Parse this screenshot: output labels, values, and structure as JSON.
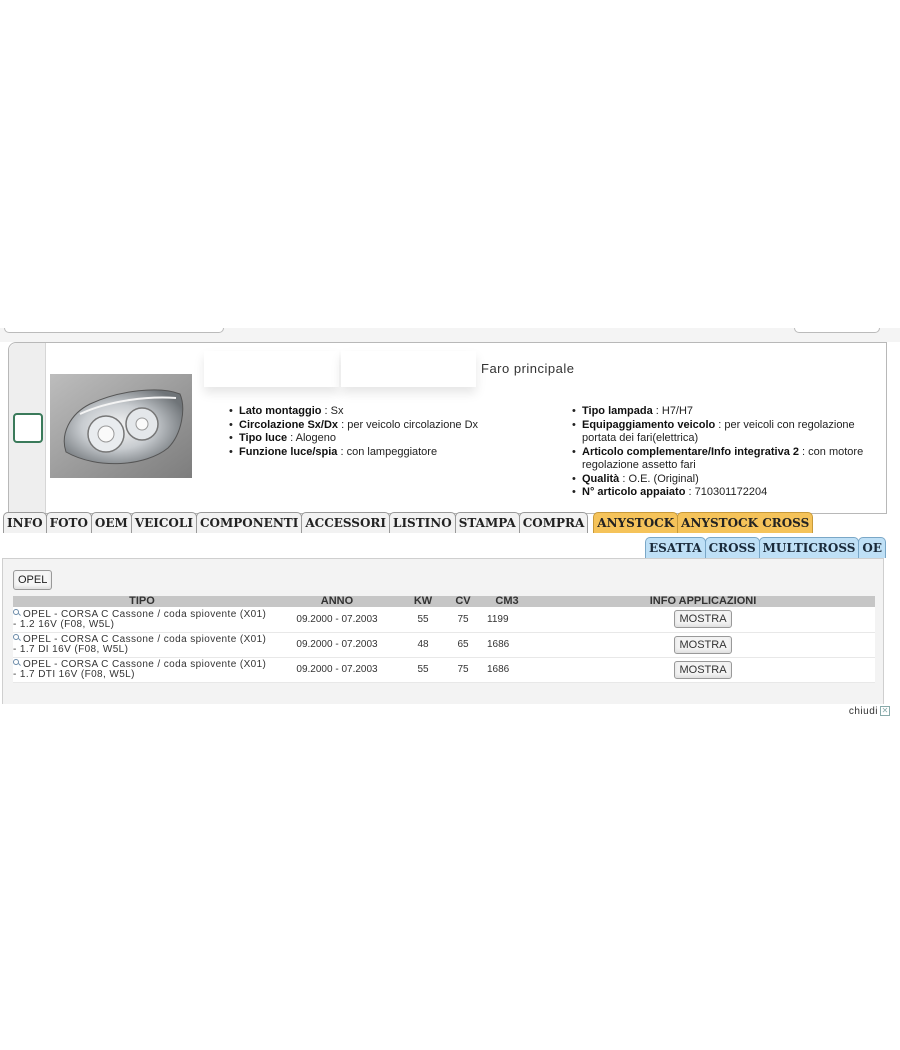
{
  "product": {
    "title": "Faro principale",
    "photo_alt": "headlamp-photo",
    "specs_left": [
      {
        "label": "Lato montaggio",
        "value": "Sx"
      },
      {
        "label": "Circolazione Sx/Dx",
        "value": "per veicolo circolazione Dx"
      },
      {
        "label": "Tipo luce",
        "value": "Alogeno"
      },
      {
        "label": "Funzione luce/spia",
        "value": "con lampeggiatore"
      }
    ],
    "specs_right": [
      {
        "label": "Tipo lampada",
        "value": "H7/H7"
      },
      {
        "label": "Equipaggiamento veicolo",
        "value": "per veicoli con regolazione portata dei fari(elettrica)"
      },
      {
        "label": "Articolo complementare/Info integrativa 2",
        "value": "con motore regolazione assetto fari"
      },
      {
        "label": "Qualità",
        "value": "O.E. (Original)"
      },
      {
        "label": "N° articolo appaiato",
        "value": "710301172204"
      }
    ]
  },
  "tabs": [
    "INFO",
    "FOTO",
    "OEM",
    "VEICOLI",
    "COMPONENTI",
    "ACCESSORI",
    "LISTINO",
    "STAMPA",
    "COMPRA"
  ],
  "tabs_highlight": [
    "ANYSTOCK",
    "ANYSTOCK CROSS"
  ],
  "subtabs": [
    "ESATTA",
    "CROSS",
    "MULTICROSS",
    "OE"
  ],
  "brand_filter": "OPEL",
  "table": {
    "headers": {
      "tipo": "TIPO",
      "anno": "ANNO",
      "kw": "KW",
      "cv": "CV",
      "cm3": "CM3",
      "info": "INFO APPLICAZIONI"
    },
    "rows": [
      {
        "tipo": "OPEL - CORSA C Cassone / coda spiovente (X01) - 1.2 16V (F08, W5L)",
        "anno": "09.2000 - 07.2003",
        "kw": "55",
        "cv": "75",
        "cm3": "1199",
        "button": "MOSTRA"
      },
      {
        "tipo": "OPEL - CORSA C Cassone / coda spiovente (X01) - 1.7 DI 16V (F08, W5L)",
        "anno": "09.2000 - 07.2003",
        "kw": "48",
        "cv": "65",
        "cm3": "1686",
        "button": "MOSTRA"
      },
      {
        "tipo": "OPEL - CORSA C Cassone / coda spiovente (X01) - 1.7 DTI 16V (F08, W5L)",
        "anno": "09.2000 - 07.2003",
        "kw": "55",
        "cv": "75",
        "cm3": "1686",
        "button": "MOSTRA"
      }
    ]
  },
  "footer": {
    "close_label": "chiudi"
  },
  "colors": {
    "tab_highlight": "#f5c35a",
    "subtab": "#bfe0f6",
    "select_border": "#3a7a5a",
    "table_header": "#c6c6c6"
  }
}
